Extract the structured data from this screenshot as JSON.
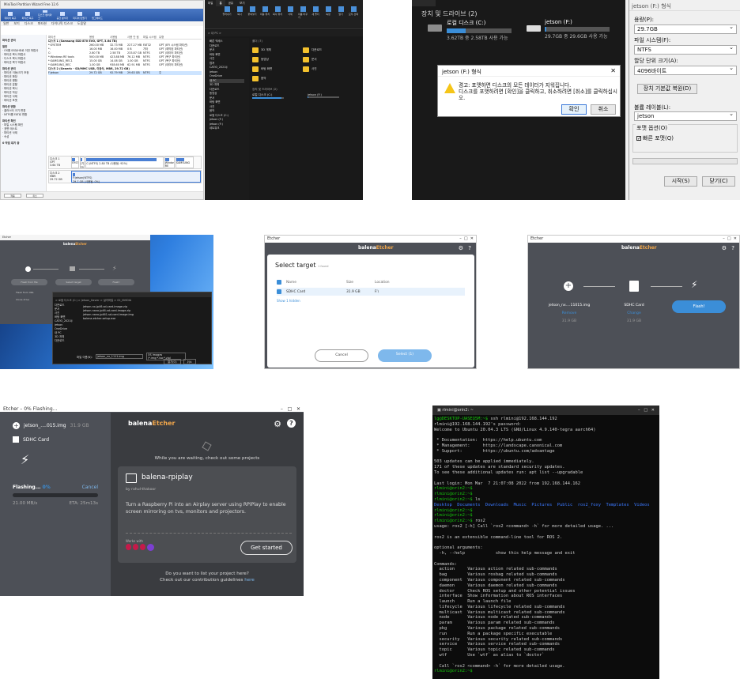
{
  "partition_wizard": {
    "title": "MiniTool Partition Wizard Free 12.6",
    "ribbon": [
      "데이터 복구",
      "파티션 복구",
      "디스크 벤치마크",
      "공간 분석기",
      "미디어 만들기",
      "업그레이드"
    ],
    "menu": [
      "일반",
      "보기",
      "디스크",
      "파티션",
      "다이나믹 디스크",
      "도움말"
    ],
    "sidebar_head": "파티션 관리",
    "sidebar": [
      {
        "t": "일반",
        "h": true
      },
      {
        "t": "OS를 SSD/HD로 이전 마법사"
      },
      {
        "t": "파티션 복사 마법사"
      },
      {
        "t": "디스크 복사 마법사"
      },
      {
        "t": "파티션 복구 마법사"
      },
      {
        "t": "파티션 관리",
        "h": true
      },
      {
        "t": "파티션 이동/크기 조정"
      },
      {
        "t": "파티션 확장"
      },
      {
        "t": "파티션 병합"
      },
      {
        "t": "파티션 분할"
      },
      {
        "t": "파티션 복사"
      },
      {
        "t": "파티션 작성"
      },
      {
        "t": "파티션 삭제"
      },
      {
        "t": "파티션 포맷"
      },
      {
        "t": "파티션 변환",
        "h": true
      },
      {
        "t": "클러스터 크기 변경"
      },
      {
        "t": "NTFS를 FAT로 변환"
      },
      {
        "t": "파티션 확인",
        "h": true
      },
      {
        "t": "파일 시스템 확인"
      },
      {
        "t": "표면 테스트"
      },
      {
        "t": "파티션 삭제"
      },
      {
        "t": "속성"
      },
      {
        "t": "0 작업 대기 중",
        "h": true
      }
    ],
    "columns": [
      "파티션",
      "용량",
      "사용됨",
      "사용 안 됨",
      "파일 시스템",
      "유형"
    ],
    "disk1": "디스크 1 (Samsung SSD 870 EVO, GPT, 3.64 TB)",
    "rows": [
      [
        "*:SYSTEM",
        "260.00 MB",
        "32.73 MB",
        "227.27 MB",
        "FAT32",
        "GPT (EFI 시스템 파티션)"
      ],
      [
        "*:",
        "16.00 MB",
        "16.00 MB",
        "0 B",
        "기타",
        "GPT (예약된 파티션)"
      ],
      [
        "C:",
        "2.80 TB",
        "2.58 TB",
        "233.87 GB",
        "NTFS",
        "GPT (데이터 파티션)"
      ],
      [
        "*:Windows RE tools",
        "500.00 MB",
        "423.88 MB",
        "76.12 MB",
        "NTFS",
        "GPT (복구 파티션)"
      ],
      [
        "*:SAMSUNG_REC1",
        "15.00 GB",
        "14.08 GB",
        "1.00 GB",
        "NTFS",
        "GPT (복구 파티션)"
      ],
      [
        "*:SAMSUNG_REC",
        "1.00 GB",
        "938.60 MB",
        "62.91 MB",
        "NTFS",
        "GPT (데이터 파티션)"
      ]
    ],
    "disk2": "디스크 2 (Generic - SD/MMC USB, 이동식, MBR, 29.72 GB)",
    "sel_row": [
      "F:jetson",
      "29.72 GB",
      "92.79 MB",
      "29.63 GB",
      "NTFS",
      "주"
    ],
    "map1": {
      "label": "디스크 1",
      "type": "GPT",
      "size": "3.64 TB",
      "parts": [
        "SYSTEM(FAT32)",
        "(기타)",
        "C:(NTFS) 2.80 TB (사용됨: 92%)",
        "Windows RE",
        "SAMSUNG"
      ]
    },
    "map2": {
      "label": "디스크 2",
      "type": "MBR",
      "size": "29.72 GB",
      "parts": [
        "F:jetson(NTFS)",
        "29.7 GB (사용됨: 0%)"
      ]
    },
    "foot": [
      "적용",
      "취소"
    ]
  },
  "explorer_dark": {
    "tabs": [
      "파일",
      "홈",
      "공유",
      "보기"
    ],
    "ribbon": [
      "잘라내기",
      "복사",
      "붙여넣기",
      "이동 위치",
      "복사 위치",
      "삭제",
      "이름 바꾸기",
      "새 폴더",
      "속성",
      "열기",
      "모두 선택"
    ],
    "address": "> 내 PC >",
    "nav": [
      "빠른 액세스",
      "다운로드",
      "문서",
      "바탕 화면",
      "사진",
      "캡쳐",
      "CATIO_2021IJ",
      "jetson",
      "OneDrive",
      "내 PC",
      "3D 개체",
      "다운로드",
      "동영상",
      "문서",
      "바탕 화면",
      "사진",
      "음악",
      "로컬 디스크 (C:)",
      "jetson (F:)",
      "jetson (F:)",
      "네트워크"
    ],
    "folders_head": "폴더 (7)",
    "folders": [
      "3D 개체",
      "다운로드",
      "동영상",
      "문서",
      "바탕 화면",
      "사진",
      "음악"
    ],
    "drives_head": "장치 및 드라이브 (2)",
    "drives": [
      {
        "name": "로컬 디스크 (C:)",
        "used": 0.92
      },
      {
        "name": "jetson (F:)",
        "used": 0.01
      }
    ]
  },
  "format_dialog": {
    "section": "장치 및 드라이브 (2)",
    "drive_c": "로컬 디스크 (C:)",
    "drive_c_free": "3.62TB 중 2.58TB 사용 가능",
    "drive_c_used": 0.29,
    "drive_f": "jetson (F:)",
    "drive_f_free": "29.7GB 중 29.6GB 사용 가능",
    "drive_f_used": 0.03,
    "title": "jetson (F:) 형식",
    "capacity_label": "용량(P):",
    "capacity": "29.7GB",
    "fs_label": "파일 시스템(F):",
    "fs": "NTFS",
    "alloc_label": "할당 단위 크기(A):",
    "alloc": "4096바이트",
    "restore": "장치 기본값 복원(D)",
    "vol_label": "볼륨 레이블(L):",
    "vol": "jetson",
    "opt_label": "포맷 옵션(O)",
    "quick": "빠른 포맷(Q)",
    "start": "시작(S)",
    "close": "닫기(C)",
    "warn_title": "jetson (F:) 형식",
    "warn_line1": "경고: 포맷하면 디스크의 모든 데이터가 지워집니다.",
    "warn_line2": "디스크를 포맷하려면 [확인]을 클릭하고, 취소하려면 [취소]를 클릭하십시오.",
    "ok": "확인",
    "cancel": "취소"
  },
  "etcher_open": {
    "title": "Etcher",
    "brand": [
      "balena",
      "Etcher"
    ],
    "btn1": "Flash from file",
    "btn2": "Select target",
    "btn3": "Flash!",
    "link1": "Flash from URL",
    "link2": "Clone drive",
    "od_path": "> 로컬 디스크 (C:) > Jetson_Xavier > 설치파일 > 02_NVIDIA",
    "od_files": [
      "jetson-nx-jp46-sd-card-image.zip",
      "jetson-nano-jp46-sd-card-image.zip",
      "jetson-nano-jp461-sd-card-image.img",
      "balena-etcher-setup.exe"
    ],
    "od_nav": [
      "다운로드",
      "문서",
      "사진",
      "바탕 화면",
      "CATIO_2021IJ",
      "jetson",
      "OneDrive",
      "내 PC",
      "3D 개체",
      "다운로드"
    ],
    "od_filename_label": "파일 이름(N):",
    "od_filename": "jetson_nx_1111.img",
    "od_filter": "OS Images (*.img;*.iso;*.zip)",
    "od_open": "열기(O)",
    "od_cancel": "취소"
  },
  "etcher_select": {
    "title": "Etcher",
    "brand": [
      "balena",
      "Etcher"
    ],
    "heading": "Select target",
    "found": "1 found",
    "cols": [
      "Name",
      "Size",
      "Location"
    ],
    "row": [
      "SDHC Card",
      "31.9 GB",
      "F:\\"
    ],
    "hidden": "Show 1 hidden",
    "cancel": "Cancel",
    "select": "Select (1)"
  },
  "etcher_ready": {
    "title": "Etcher",
    "brand": [
      "balena",
      "Etcher"
    ],
    "image": "jetson_nx....11015.img",
    "image_action": "Remove",
    "image_size": "31.9 GB",
    "target": "SDHC Card",
    "target_action": "Change",
    "target_size": "31.9 GB",
    "flash": "Flash!"
  },
  "etcher_flashing": {
    "title": "Etcher – 0% Flashing...",
    "brand": [
      "balena",
      "Etcher"
    ],
    "image": "jetson_....015.img",
    "image_size": "31.9 GB",
    "target": "SDHC Card",
    "status": "Flashing...",
    "percent": "0%",
    "progress": 0.0,
    "cancel": "Cancel",
    "speed": "21.00 MB/s",
    "eta": "ETA: 25m13s",
    "waiting": "While you are waiting, check out some projects",
    "project": "balena-rpiplay",
    "author": "by rahul-thakoor",
    "desc": "Turn a Raspberry Pi into an Airplay server using RPiPlay to enable screen mirroring on tvs, monitors and projectors.",
    "works_with": "Works with",
    "get_started": "Get started",
    "footer1": "Do you want to list your project here?",
    "footer2": "Check out our contribution guidelines",
    "footer_link": "here"
  },
  "terminal": {
    "title": "rlmini@orin2: ~",
    "lines": [
      {
        "p": "lg@DESKTOP-UASEQ5M:~$ ",
        "t": "ssh rlmini@192.168.144.192"
      },
      {
        "t": "rlmini@192.168.144.192's password:"
      },
      {
        "t": "Welcome to Ubuntu 20.04.3 LTS (GNU/Linux 4.9.140-tegra aarch64)"
      },
      {
        "t": ""
      },
      {
        "t": " * Documentation:  https://help.ubuntu.com"
      },
      {
        "t": " * Management:     https://landscape.canonical.com"
      },
      {
        "t": " * Support:        https://ubuntu.com/advantage"
      },
      {
        "t": ""
      },
      {
        "t": "503 updates can be applied immediately."
      },
      {
        "t": "171 of these updates are standard security updates."
      },
      {
        "t": "To see these additional updates run: apt list --upgradable"
      },
      {
        "t": ""
      },
      {
        "t": "Last login: Mon Mar  7 21:07:08 2022 from 192.168.144.162"
      },
      {
        "p": "rlmini@orin2:~$ ",
        "t": ""
      },
      {
        "p": "rlmini@orin2:~$ ",
        "t": ""
      },
      {
        "p": "rlmini@orin2:~$ ",
        "t": "ls"
      },
      {
        "ls": "Desktop  Documents  Downloads  Music  Pictures  Public  ros2_foxy  Templates  Videos"
      },
      {
        "p": "rlmini@orin2:~$ ",
        "t": ""
      },
      {
        "p": "rlmini@orin2:~$ ",
        "t": ""
      },
      {
        "p": "rlmini@orin2:~$ ",
        "t": "ros2"
      },
      {
        "t": "usage: ros2 [-h] Call `ros2 <command> -h` for more detailed usage. ..."
      },
      {
        "t": ""
      },
      {
        "t": "ros2 is an extensible command-line tool for ROS 2."
      },
      {
        "t": ""
      },
      {
        "t": "optional arguments:"
      },
      {
        "t": "  -h, --help            show this help message and exit"
      },
      {
        "t": ""
      },
      {
        "t": "Commands:"
      },
      {
        "t": "  action     Various action related sub-commands"
      },
      {
        "t": "  bag        Various rosbag related sub-commands"
      },
      {
        "t": "  component  Various component related sub-commands"
      },
      {
        "t": "  daemon     Various daemon related sub-commands"
      },
      {
        "t": "  doctor     Check ROS setup and other potential issues"
      },
      {
        "t": "  interface  Show information about ROS interfaces"
      },
      {
        "t": "  launch     Run a launch file"
      },
      {
        "t": "  lifecycle  Various lifecycle related sub-commands"
      },
      {
        "t": "  multicast  Various multicast related sub-commands"
      },
      {
        "t": "  node       Various node related sub-commands"
      },
      {
        "t": "  param      Various param related sub-commands"
      },
      {
        "t": "  pkg        Various package related sub-commands"
      },
      {
        "t": "  run        Run a package specific executable"
      },
      {
        "t": "  security   Various security related sub-commands"
      },
      {
        "t": "  service    Various service related sub-commands"
      },
      {
        "t": "  topic      Various topic related sub-commands"
      },
      {
        "t": "  wtf        Use `wtf` as alias to `doctor`"
      },
      {
        "t": ""
      },
      {
        "t": "  Call `ros2 <command> -h` for more detailed usage."
      },
      {
        "p": "rlmini@orin2:~$ ",
        "t": ""
      }
    ]
  },
  "colors": {
    "etcher_bg": "#4d5057",
    "etcher_blue": "#3b8ed8",
    "terminal_green": "#16c60c",
    "terminal_blue": "#3b78ff",
    "brand_orange": "#f0a64b"
  }
}
